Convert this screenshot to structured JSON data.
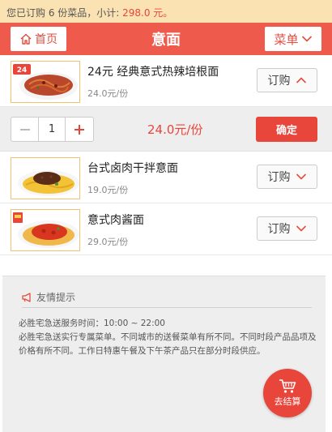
{
  "summary": {
    "prefix": "您已订购 6 份菜品，小计: ",
    "amount": "298.0 元。"
  },
  "header": {
    "home_label": "首页",
    "title": "意面",
    "menu_label": "菜单"
  },
  "items": [
    {
      "name": "24元 经典意式热辣培根面",
      "price": "24.0元/份",
      "order_label": "订购",
      "badge": "24",
      "expanded": true
    },
    {
      "name": "台式卤肉干拌意面",
      "price": "19.0元/份",
      "order_label": "订购",
      "expanded": false
    },
    {
      "name": "意式肉酱面",
      "price": "29.0元/份",
      "order_label": "订购",
      "expanded": false
    }
  ],
  "expand": {
    "quantity": "1",
    "sum": "24.0元/份",
    "confirm_label": "确定"
  },
  "notice": {
    "title": "友情提示",
    "line1": "必胜宅急送服务时间：10:00 ~ 22:00",
    "line2": "必胜宅急送实行专属菜单。不同城市的送餐菜单有所不同。不同时段产品品项及价格有所不同。工作日特惠午餐及下午茶产品只在部分时段供应。"
  },
  "checkout": {
    "label": "去结算"
  },
  "colors": {
    "accent": "#ee5a4c",
    "price": "#e9453a",
    "banner": "#fbe2b3"
  }
}
